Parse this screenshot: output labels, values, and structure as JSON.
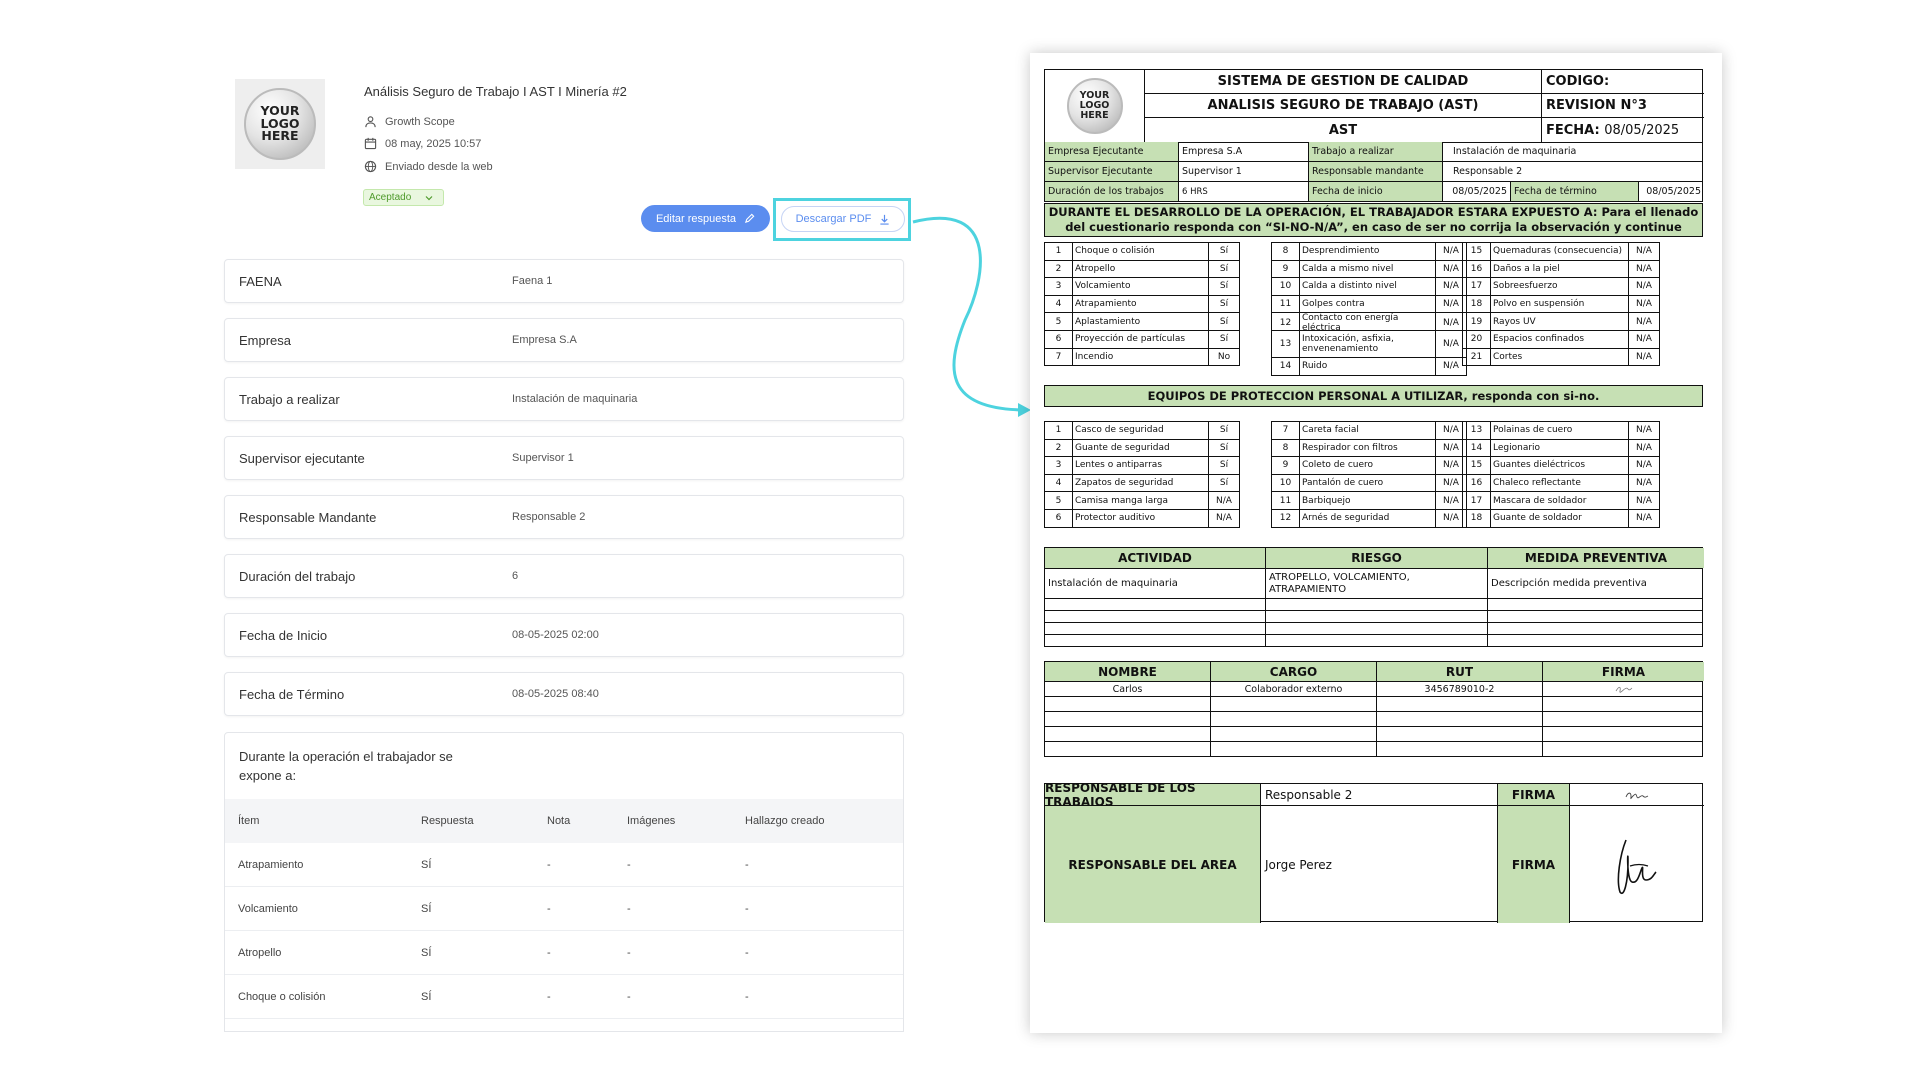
{
  "form": {
    "logo_text": [
      "YOUR",
      "LOGO",
      "HERE"
    ],
    "title": "Análisis Seguro de Trabajo I AST I Minería #2",
    "scope": "Growth Scope",
    "date": "08 may, 2025 10:57",
    "sent_from": "Enviado desde la web",
    "status": "Aceptado",
    "edit_label": "Editar respuesta",
    "download_label": "Descargar PDF",
    "fields": [
      {
        "label": "FAENA",
        "value": "Faena 1"
      },
      {
        "label": "Empresa",
        "value": "Empresa S.A"
      },
      {
        "label": "Trabajo a realizar",
        "value": "Instalación de maquinaria"
      },
      {
        "label": "Supervisor ejecutante",
        "value": "Supervisor 1"
      },
      {
        "label": "Responsable Mandante",
        "value": "Responsable 2"
      },
      {
        "label": "Duración del trabajo",
        "value": "6"
      },
      {
        "label": "Fecha de Inicio",
        "value": "08-05-2025 02:00"
      },
      {
        "label": "Fecha de Término",
        "value": "08-05-2025 08:40"
      }
    ],
    "exposure_question": "Durante la operación el trabajador se expone a:",
    "exposure_columns": [
      "Ítem",
      "Respuesta",
      "Nota",
      "Imágenes",
      "Hallazgo creado"
    ],
    "exposure_rows": [
      [
        "Atrapamiento",
        "SÍ",
        "-",
        "-",
        "-"
      ],
      [
        "Volcamiento",
        "SÍ",
        "-",
        "-",
        "-"
      ],
      [
        "Atropello",
        "SÍ",
        "-",
        "-",
        "-"
      ],
      [
        "Choque o colisión",
        "SÍ",
        "-",
        "-",
        "-"
      ]
    ]
  },
  "pdf": {
    "header_title1": "SISTEMA DE GESTION DE CALIDAD",
    "header_title2": "ANALISIS SEGURO DE TRABAJO (AST)",
    "header_title3": "AST",
    "codigo": "CODIGO:",
    "revision": "REVISION N°3",
    "fecha_label": "FECHA:",
    "fecha_value": "08/05/2025",
    "info": {
      "empresa_ejecutante_label": "Empresa Ejecutante",
      "empresa_ejecutante": "Empresa S.A",
      "trabajo_label": "Trabajo a realizar",
      "trabajo": "Instalación de maquinaria",
      "supervisor_label": "Supervisor Ejecutante",
      "supervisor": "Supervisor 1",
      "responsable_label": "Responsable mandante",
      "responsable": "Responsable 2",
      "duracion_label": "Duración de los trabajos",
      "duracion": "6 HRS",
      "inicio_label": "Fecha de inicio",
      "inicio": "08/05/2025",
      "termino_label": "Fecha de término",
      "termino": "08/05/2025"
    },
    "hazard_title": "DURANTE EL DESARROLLO DE LA OPERACIÓN, EL TRABAJADOR ESTARA EXPUESTO A: Para el llenado del cuestionario responda con “SI-NO-N/A”, en caso de ser no corrija la observación y continue",
    "hazards_col1": [
      [
        "1",
        "Choque o colisión",
        "Sí"
      ],
      [
        "2",
        "Atropello",
        "Sí"
      ],
      [
        "3",
        "Volcamiento",
        "Sí"
      ],
      [
        "4",
        "Atrapamiento",
        "Sí"
      ],
      [
        "5",
        "Aplastamiento",
        "Sí"
      ],
      [
        "6",
        "Proyección de partículas",
        "Sí"
      ],
      [
        "7",
        "Incendio",
        "No"
      ]
    ],
    "hazards_col2": [
      [
        "8",
        "Desprendimiento",
        "N/A"
      ],
      [
        "9",
        "Calda a mismo nivel",
        "N/A"
      ],
      [
        "10",
        "Calda a distinto nivel",
        "N/A"
      ],
      [
        "11",
        "Golpes contra",
        "N/A"
      ],
      [
        "12",
        "Contacto con energía eléctrica",
        "N/A"
      ],
      [
        "13",
        "Intoxicación, asfixia, envenenamiento",
        "N/A"
      ],
      [
        "14",
        "Ruido",
        "N/A"
      ]
    ],
    "hazards_col3": [
      [
        "15",
        "Quemaduras (consecuencia)",
        "N/A"
      ],
      [
        "16",
        "Daños a la piel",
        "N/A"
      ],
      [
        "17",
        "Sobreesfuerzo",
        "N/A"
      ],
      [
        "18",
        "Polvo en suspensión",
        "N/A"
      ],
      [
        "19",
        "Rayos UV",
        "N/A"
      ],
      [
        "20",
        "Espacios confinados",
        "N/A"
      ],
      [
        "21",
        "Cortes",
        "N/A"
      ]
    ],
    "ppe_title": "EQUIPOS DE PROTECCION PERSONAL A UTILIZAR, responda con si-no.",
    "ppe_col1": [
      [
        "1",
        "Casco de seguridad",
        "Sí"
      ],
      [
        "2",
        "Guante de seguridad",
        "Sí"
      ],
      [
        "3",
        "Lentes o antiparras",
        "Sí"
      ],
      [
        "4",
        "Zapatos de seguridad",
        "Sí"
      ],
      [
        "5",
        "Camisa manga larga",
        "N/A"
      ],
      [
        "6",
        "Protector auditivo",
        "N/A"
      ]
    ],
    "ppe_col2": [
      [
        "7",
        "Careta facial",
        "N/A"
      ],
      [
        "8",
        "Respirador con filtros",
        "N/A"
      ],
      [
        "9",
        "Coleto de cuero",
        "N/A"
      ],
      [
        "10",
        "Pantalón de cuero",
        "N/A"
      ],
      [
        "11",
        "Barbiquejo",
        "N/A"
      ],
      [
        "12",
        "Arnés de seguridad",
        "N/A"
      ]
    ],
    "ppe_col3": [
      [
        "13",
        "Polainas de cuero",
        "N/A"
      ],
      [
        "14",
        "Legionario",
        "N/A"
      ],
      [
        "15",
        "Guantes dieléctricos",
        "N/A"
      ],
      [
        "16",
        "Chaleco reflectante",
        "N/A"
      ],
      [
        "17",
        "Mascara de soldador",
        "N/A"
      ],
      [
        "18",
        "Guante de soldador",
        "N/A"
      ]
    ],
    "activity_headers": [
      "ACTIVIDAD",
      "RIESGO",
      "MEDIDA PREVENTIVA"
    ],
    "activity_row": [
      "Instalación de maquinaria",
      "ATROPELLO, VOLCAMIENTO, ATRAPAMIENTO",
      "Descripción medida preventiva"
    ],
    "signature_headers": [
      "NOMBRE",
      "CARGO",
      "RUT",
      "FIRMA"
    ],
    "signature_row": [
      "Carlos",
      "Colaborador externo",
      "3456789010-2"
    ],
    "resp_trabajos_label": "RESPONSABLE DE LOS TRABAJOS",
    "resp_trabajos_value": "Responsable 2",
    "resp_area_label": "RESPONSABLE DEL AREA",
    "resp_area_value": "Jorge Perez",
    "firma_label": "FIRMA"
  },
  "colors": {
    "accent": "#5b8def",
    "highlight": "#4dd3df",
    "table_green": "#c6e0b4",
    "badge_green": "#4f9a2c"
  }
}
